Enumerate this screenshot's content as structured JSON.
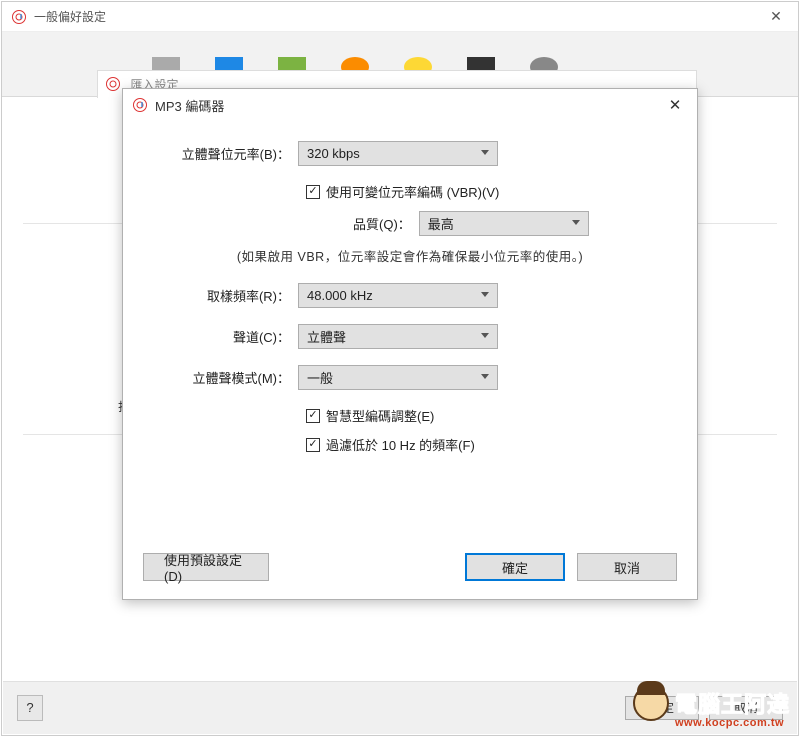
{
  "parent": {
    "title": "一般偏好設定",
    "childHint": "匯入設定",
    "truncChar": "打",
    "footer": {
      "help": "?",
      "ok": "確定",
      "cancel": "取消"
    }
  },
  "modal": {
    "title": "MP3 編碼器",
    "bitrate": {
      "label": "立體聲位元率(B)：",
      "value": "320 kbps"
    },
    "vbr": {
      "label": "使用可變位元率編碼 (VBR)(V)"
    },
    "quality": {
      "label": "品質(Q)：",
      "value": "最高"
    },
    "note": "(如果啟用 VBR，位元率設定會作為確保最小位元率的使用。)",
    "samplerate": {
      "label": "取樣頻率(R)：",
      "value": "48.000 kHz"
    },
    "channel": {
      "label": "聲道(C)：",
      "value": "立體聲"
    },
    "stereomode": {
      "label": "立體聲模式(M)：",
      "value": "一般"
    },
    "smart": {
      "label": "智慧型編碼調整(E)"
    },
    "filter10hz": {
      "label": "過濾低於 10 Hz 的頻率(F)"
    },
    "buttons": {
      "defaults": "使用預設設定(D)",
      "ok": "確定",
      "cancel": "取消"
    }
  },
  "watermark": {
    "line1": "電腦王阿達",
    "line2": "www.kocpc.com.tw"
  }
}
